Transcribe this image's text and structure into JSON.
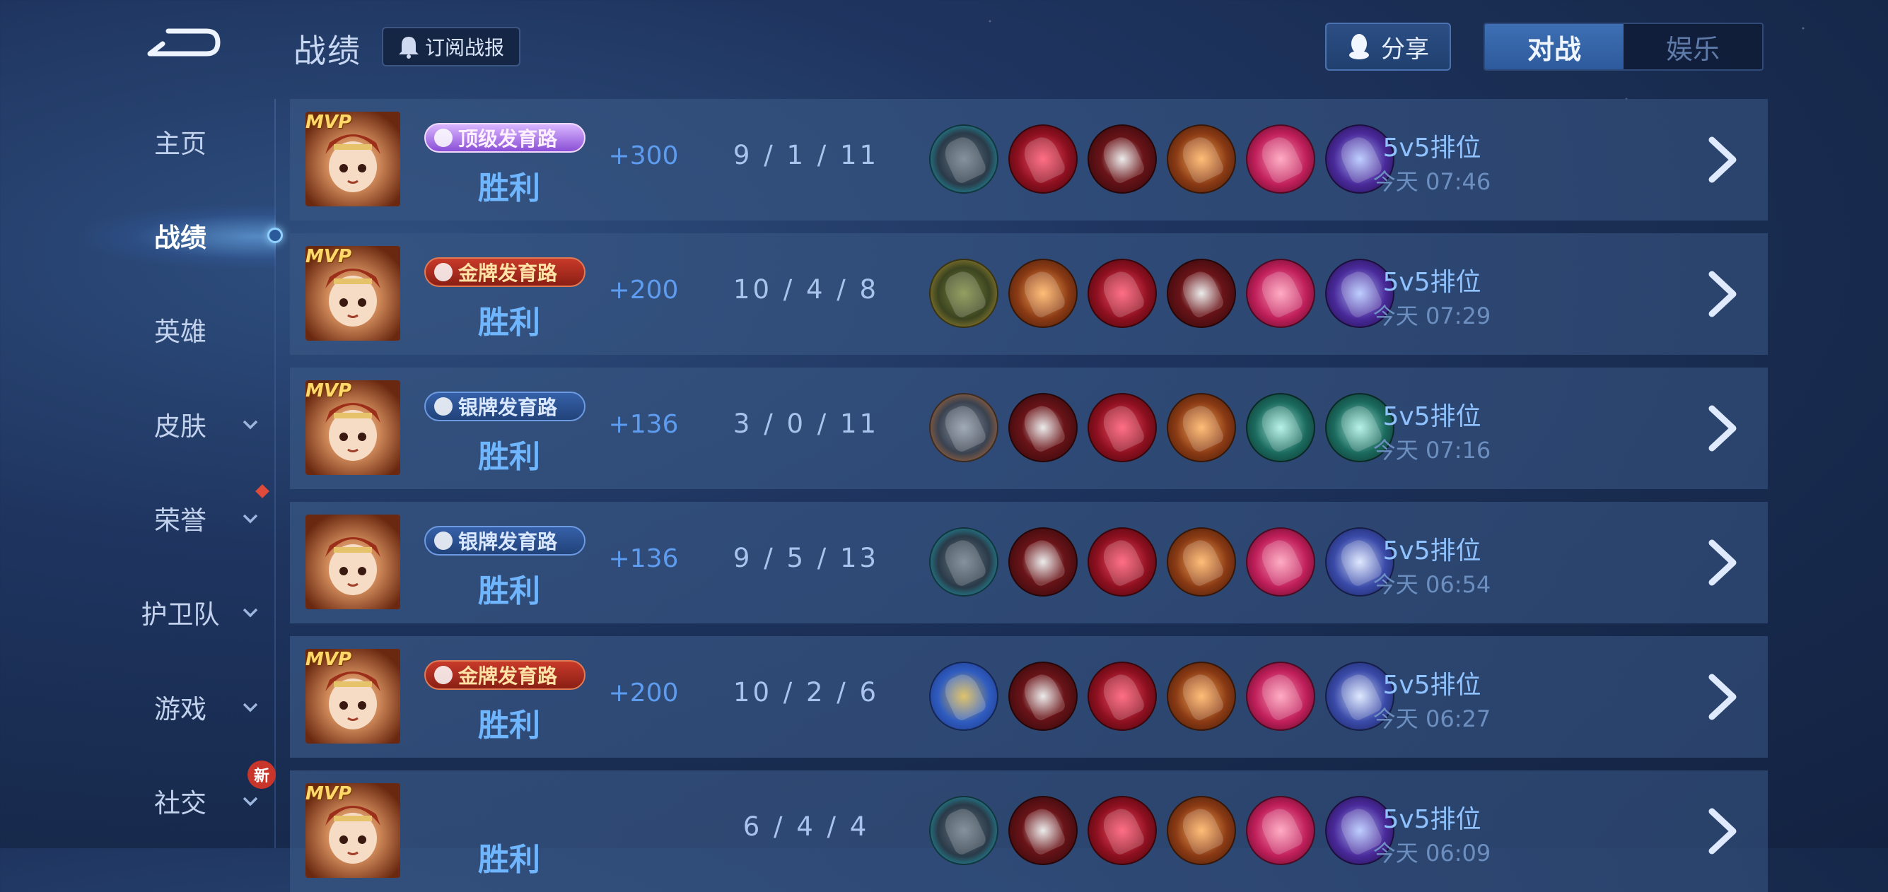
{
  "header": {
    "title": "战绩",
    "subscribe_label": "订阅战报",
    "share_label": "分享",
    "mode_tabs": [
      {
        "label": "对战",
        "active": true
      },
      {
        "label": "娱乐",
        "active": false
      }
    ]
  },
  "sidebar": {
    "items": [
      {
        "label": "主页",
        "active": false,
        "has_chevron": false
      },
      {
        "label": "战绩",
        "active": true,
        "has_chevron": false
      },
      {
        "label": "英雄",
        "active": false,
        "has_chevron": false
      },
      {
        "label": "皮肤",
        "active": false,
        "has_chevron": true
      },
      {
        "label": "荣誉",
        "active": false,
        "has_chevron": true
      },
      {
        "label": "护卫队",
        "active": false,
        "has_chevron": true
      },
      {
        "label": "游戏",
        "active": false,
        "has_chevron": true
      },
      {
        "label": "社交",
        "active": false,
        "has_chevron": true
      }
    ],
    "new_badge": "新"
  },
  "matches": [
    {
      "mvp": "MVP",
      "badge": "顶级发育路",
      "badge_style": "purple",
      "result": "胜利",
      "score": "+300",
      "kda": "9 / 1 / 11",
      "items": [
        "boots-teal",
        "mask-red",
        "blade-red",
        "blade-orange",
        "blade-pink",
        "staff-purple"
      ],
      "mode": "5v5排位",
      "time": "今天 07:46"
    },
    {
      "mvp": "MVP",
      "badge": "金牌发育路",
      "badge_style": "gold",
      "result": "胜利",
      "score": "+200",
      "kda": "10 / 4 / 8",
      "items": [
        "boots-gold",
        "blade-orange",
        "mask-red",
        "blade-red",
        "blade-pink",
        "staff-purple"
      ],
      "mode": "5v5排位",
      "time": "今天 07:29"
    },
    {
      "mvp": "MVP",
      "badge": "银牌发育路",
      "badge_style": "silver",
      "result": "胜利",
      "score": "+136",
      "kda": "3 / 0 / 11",
      "items": [
        "boots-orange",
        "blade-red",
        "mask-red",
        "blade-orange",
        "blade-green",
        "blade-green"
      ],
      "mode": "5v5排位",
      "time": "今天 07:16"
    },
    {
      "mvp": "",
      "badge": "银牌发育路",
      "badge_style": "silver",
      "result": "胜利",
      "score": "+136",
      "kda": "9 / 5 / 13",
      "items": [
        "boots-teal",
        "blade-red",
        "mask-red",
        "blade-orange",
        "blade-pink",
        "blade-blue"
      ],
      "mode": "5v5排位",
      "time": "今天 06:54"
    },
    {
      "mvp": "MVP",
      "badge": "金牌发育路",
      "badge_style": "gold",
      "result": "胜利",
      "score": "+200",
      "kda": "10 / 2 / 6",
      "items": [
        "armor-blue",
        "blade-red",
        "mask-red",
        "blade-orange",
        "blade-pink",
        "blade-blue"
      ],
      "mode": "5v5排位",
      "time": "今天 06:27"
    },
    {
      "mvp": "MVP",
      "badge": "",
      "badge_style": "",
      "result": "胜利",
      "score": "",
      "kda": "6 / 4 / 4",
      "items": [
        "boots-teal",
        "blade-red",
        "mask-red",
        "blade-orange",
        "blade-pink",
        "staff-purple"
      ],
      "mode": "5v5排位",
      "time": "今天 06:09"
    }
  ]
}
